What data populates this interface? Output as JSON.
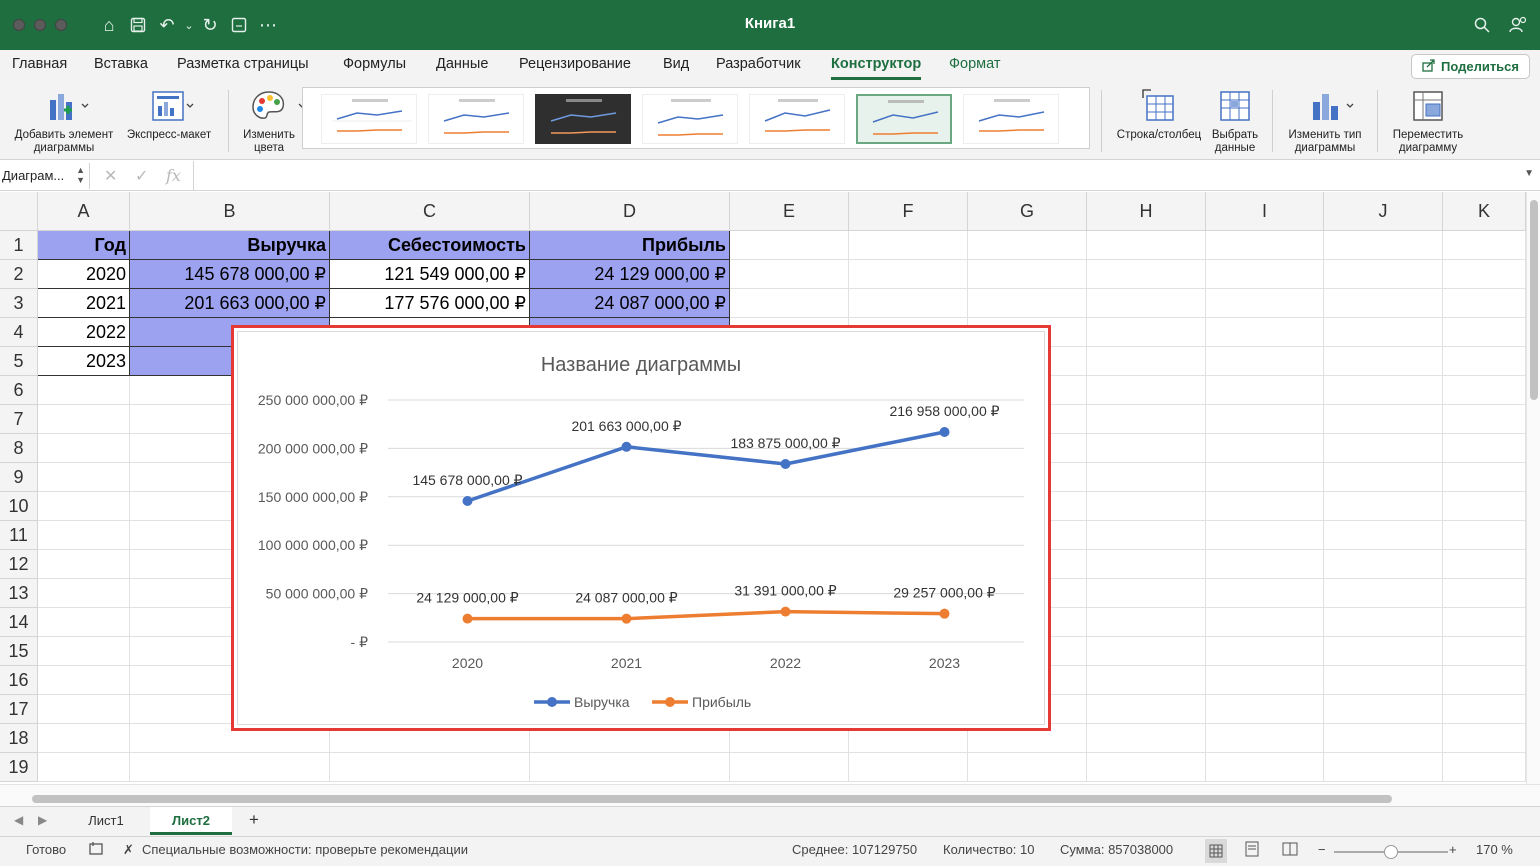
{
  "window": {
    "title": "Книга1"
  },
  "tabs": [
    "Главная",
    "Вставка",
    "Разметка страницы",
    "Формулы",
    "Данные",
    "Рецензирование",
    "Вид",
    "Разработчик",
    "Конструктор",
    "Формат"
  ],
  "active_tab": "Конструктор",
  "share_label": "Поделиться",
  "ribbon": {
    "add_element": "Добавить элемент диаграммы",
    "quick_layout": "Экспресс-макет",
    "change_colors": "Изменить цвета",
    "switch_row_col": "Строка/столбец",
    "select_data": "Выбрать данные",
    "change_type": "Изменить тип диаграммы",
    "move_chart": "Переместить диаграмму"
  },
  "formula_bar": {
    "name_box": "Диаграм...",
    "fx": "fx"
  },
  "columns": [
    "A",
    "B",
    "C",
    "D",
    "E",
    "F",
    "G",
    "H",
    "I",
    "J",
    "K"
  ],
  "rows": [
    "1",
    "2",
    "3",
    "4",
    "5",
    "6",
    "7",
    "8",
    "9",
    "10",
    "11",
    "12",
    "13",
    "14",
    "15",
    "16",
    "17",
    "18",
    "19"
  ],
  "table": {
    "headers": [
      "Год",
      "Выручка",
      "Себестоимость",
      "Прибыль"
    ],
    "rows": [
      [
        "2020",
        "145 678 000,00 ₽",
        "121 549 000,00 ₽",
        "24 129 000,00 ₽"
      ],
      [
        "2021",
        "201 663 000,00 ₽",
        "177 576 000,00 ₽",
        "24 087 000,00 ₽"
      ],
      [
        "2022",
        "183 87",
        "",
        ""
      ],
      [
        "2023",
        "216 95",
        "",
        ""
      ]
    ]
  },
  "chart_data": {
    "type": "line",
    "title": "Название диаграммы",
    "categories": [
      "2020",
      "2021",
      "2022",
      "2023"
    ],
    "series": [
      {
        "name": "Выручка",
        "color": "#4472c4",
        "values": [
          145678000,
          201663000,
          183875000,
          216958000
        ],
        "labels": [
          "145 678 000,00 ₽",
          "201 663 000,00 ₽",
          "183 875 000,00 ₽",
          "216 958 000,00 ₽"
        ]
      },
      {
        "name": "Прибыль",
        "color": "#ed7d31",
        "values": [
          24129000,
          24087000,
          31391000,
          29257000
        ],
        "labels": [
          "24 129 000,00 ₽",
          "24 087 000,00 ₽",
          "31 391 000,00 ₽",
          "29 257 000,00 ₽"
        ]
      }
    ],
    "ylim": [
      0,
      250000000
    ],
    "yticks": [
      0,
      50000000,
      100000000,
      150000000,
      200000000,
      250000000
    ],
    "ytick_labels": [
      "-   ₽",
      "50 000 000,00 ₽",
      "100 000 000,00 ₽",
      "150 000 000,00 ₽",
      "200 000 000,00 ₽",
      "250 000 000,00 ₽"
    ],
    "grid": true,
    "legend": "bottom"
  },
  "sheets": [
    "Лист1",
    "Лист2"
  ],
  "active_sheet": "Лист2",
  "add_sheet": "+",
  "status": {
    "ready": "Готово",
    "accessibility": "Специальные возможности: проверьте рекомендации",
    "average": "Среднее: 107129750",
    "count": "Количество: 10",
    "sum": "Сумма: 857038000",
    "zoom_minus": "−",
    "zoom_plus": "+",
    "zoom": "170 %",
    "zoom_fraction": 0.5
  },
  "colors": {
    "brand": "#1e6e3f",
    "header_fill": "#9da2f0",
    "selection": "#e53935"
  }
}
